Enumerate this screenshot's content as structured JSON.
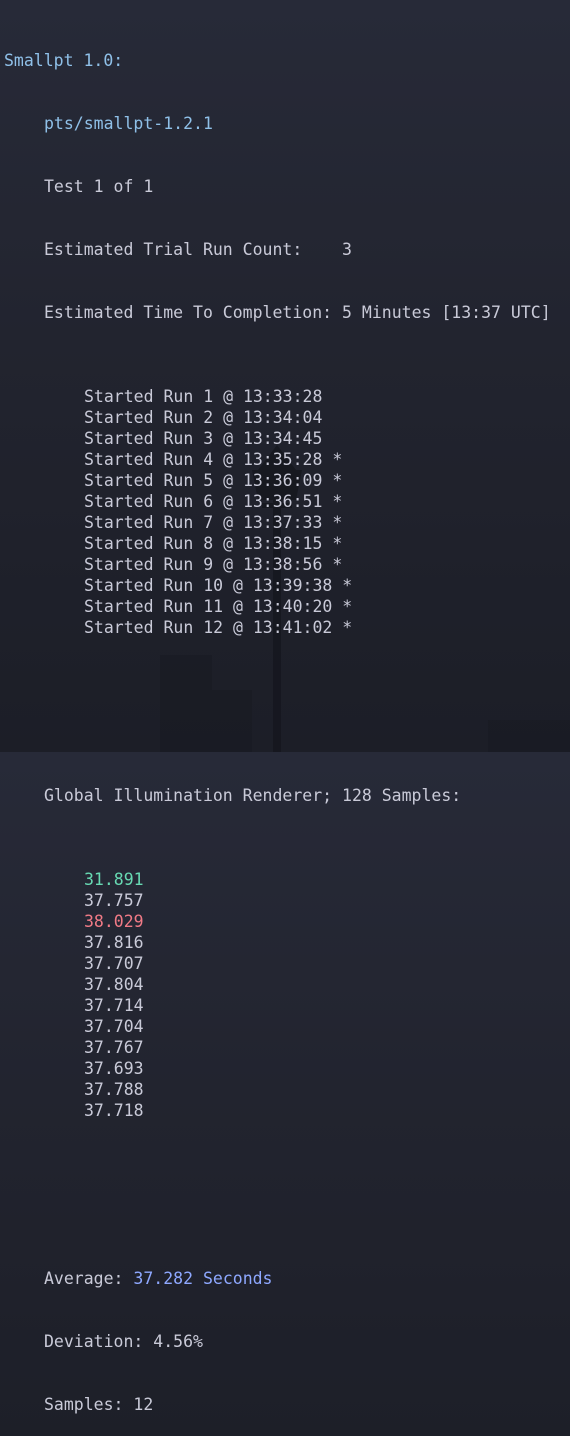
{
  "colors": {
    "title": "#8fc0e8",
    "text": "#c9cad8",
    "accent": "#8ea8ff",
    "min": "#67d9b2",
    "max": "#f07a86"
  },
  "header": {
    "title": "Smallpt 1.0:",
    "test_id": "pts/smallpt-1.2.1",
    "test_count": "Test 1 of 1",
    "trial_label": "Estimated Trial Run Count:",
    "trial_value": "3",
    "time_label": "Estimated Time To Completion:",
    "time_value": "5 Minutes [13:37 UTC]"
  },
  "runs": [
    {
      "label": "Started Run 1 @ 13:33:28",
      "mark": ""
    },
    {
      "label": "Started Run 2 @ 13:34:04",
      "mark": ""
    },
    {
      "label": "Started Run 3 @ 13:34:45",
      "mark": ""
    },
    {
      "label": "Started Run 4 @ 13:35:28",
      "mark": "*"
    },
    {
      "label": "Started Run 5 @ 13:36:09",
      "mark": "*"
    },
    {
      "label": "Started Run 6 @ 13:36:51",
      "mark": "*"
    },
    {
      "label": "Started Run 7 @ 13:37:33",
      "mark": "*"
    },
    {
      "label": "Started Run 8 @ 13:38:15",
      "mark": "*"
    },
    {
      "label": "Started Run 9 @ 13:38:56",
      "mark": "*"
    },
    {
      "label": "Started Run 10 @ 13:39:38",
      "mark": "*"
    },
    {
      "label": "Started Run 11 @ 13:40:20",
      "mark": "*"
    },
    {
      "label": "Started Run 12 @ 13:41:02",
      "mark": "*"
    }
  ],
  "result": {
    "heading": "Global Illumination Renderer; 128 Samples:",
    "values": [
      "31.891",
      "37.757",
      "38.029",
      "37.816",
      "37.707",
      "37.804",
      "37.714",
      "37.704",
      "37.767",
      "37.693",
      "37.788",
      "37.718"
    ],
    "min_index": 0,
    "max_index": 2
  },
  "summary": {
    "average_label": "Average:",
    "average_value": "37.282 Seconds",
    "deviation_label": "Deviation:",
    "deviation_value": "4.56%",
    "samples_label": "Samples:",
    "samples_value": "12"
  }
}
